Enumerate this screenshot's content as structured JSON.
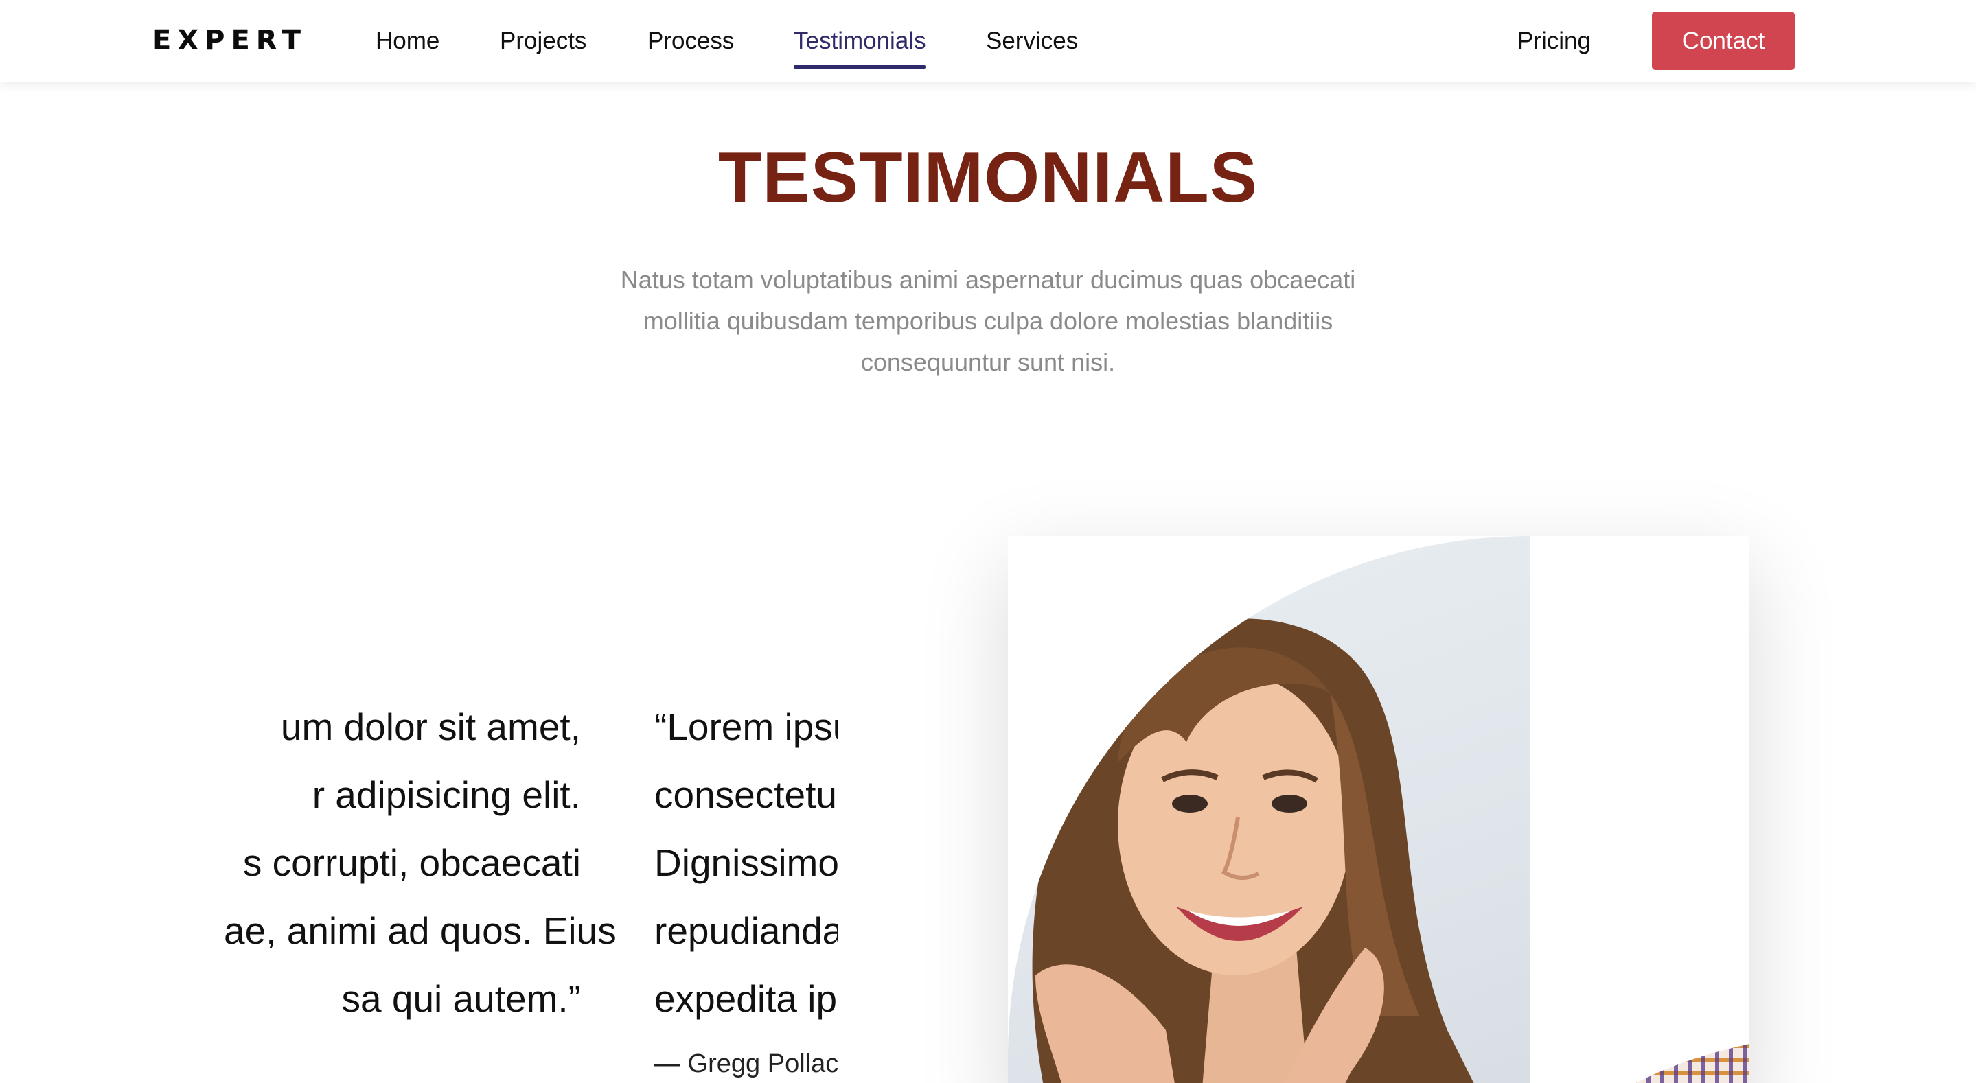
{
  "header": {
    "brand": "EXPERT",
    "nav": [
      {
        "label": "Home"
      },
      {
        "label": "Projects"
      },
      {
        "label": "Process"
      },
      {
        "label": "Testimonials",
        "active": true
      },
      {
        "label": "Services"
      }
    ],
    "pricing_label": "Pricing",
    "contact_label": "Contact"
  },
  "section": {
    "title": "TESTIMONIALS",
    "subtitle_lines": [
      "Natus totam voluptatibus animi aspernatur ducimus quas obcaecati",
      "mollitia quibusdam temporibus culpa dolore molestias blanditiis",
      "consequuntur sunt nisi."
    ]
  },
  "testimonials": [
    {
      "lines": [
        "um dolor sit amet,",
        "r adipisicing elit.",
        "s corrupti, obcaecati",
        "ae, animi ad quos. Eius",
        "sa qui autem.”"
      ]
    },
    {
      "lines": [
        "“Lorem ipsu",
        "consectetu",
        "Dignissimo",
        "repudianda",
        "expedita ip"
      ],
      "author": "— Gregg Pollac"
    }
  ],
  "colors": {
    "title": "#762314",
    "accent_nav": "#2f2a6a",
    "contact_bg": "#d0454f",
    "subtitle": "#8a8a8a"
  },
  "photo": {
    "icon": "person-photo"
  }
}
